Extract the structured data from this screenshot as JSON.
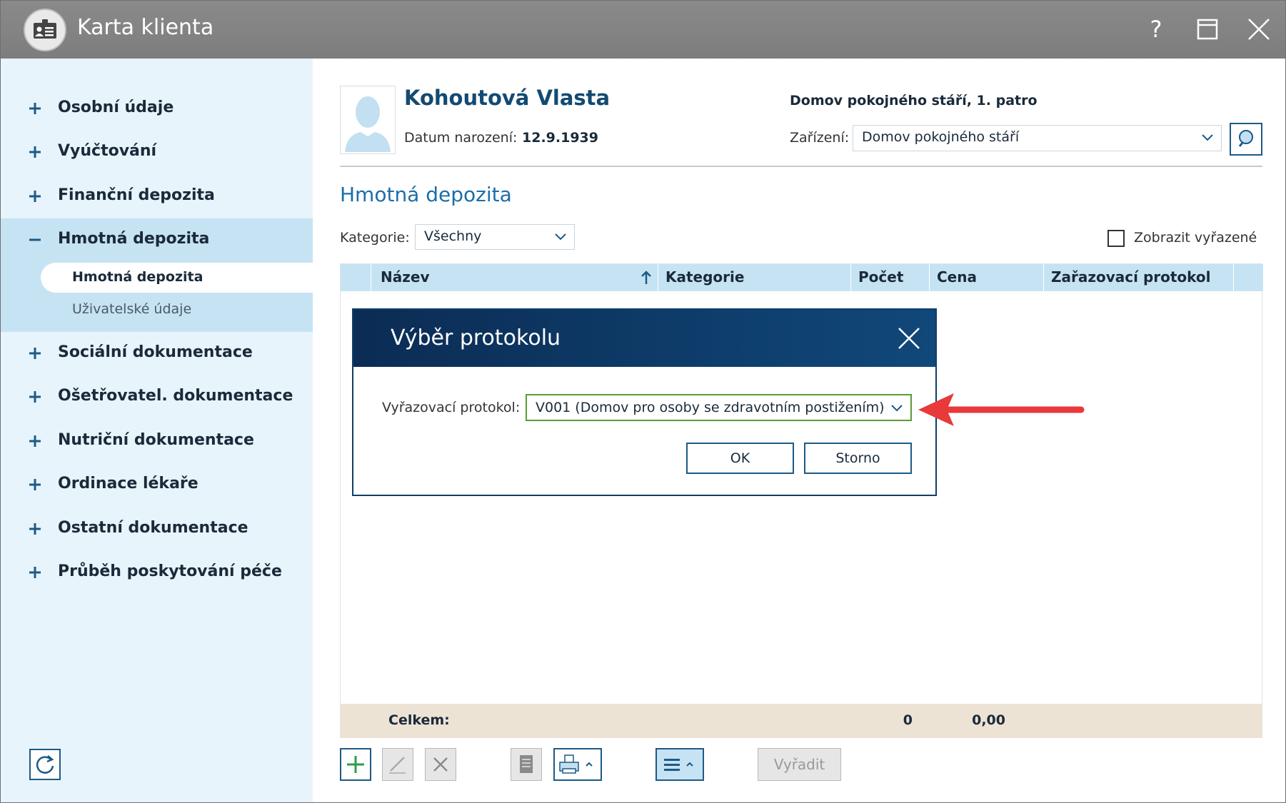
{
  "window": {
    "title": "Karta klienta",
    "help_label": "?"
  },
  "sidebar": {
    "items": [
      {
        "label": "Osobní údaje"
      },
      {
        "label": "Vyúčtování"
      },
      {
        "label": "Finanční depozita"
      },
      {
        "label": "Hmotná depozita"
      },
      {
        "label": "Sociální dokumentace"
      },
      {
        "label": "Ošetřovatel. dokumentace"
      },
      {
        "label": "Nutriční dokumentace"
      },
      {
        "label": "Ordinace lékaře"
      },
      {
        "label": "Ostatní dokumentace"
      },
      {
        "label": "Průběh poskytování péče"
      }
    ],
    "subitems": [
      {
        "label": "Hmotná depozita"
      },
      {
        "label": "Uživatelské údaje"
      }
    ]
  },
  "client": {
    "name": "Kohoutová Vlasta",
    "dob_label": "Datum narození:",
    "dob_value": "12.9.1939",
    "location": "Domov pokojného stáří, 1. patro",
    "facility_label": "Zařízení:",
    "facility_value": "Domov pokojného stáří"
  },
  "section": {
    "title": "Hmotná depozita",
    "category_label": "Kategorie:",
    "category_value": "Všechny",
    "show_discarded_label": "Zobrazit vyřazené"
  },
  "grid": {
    "columns": [
      "Název",
      "Kategorie",
      "Počet",
      "Cena",
      "Zařazovací protokol"
    ],
    "sort_icon": "arrow-up-icon",
    "footer_label": "Celkem:",
    "footer_count": "0",
    "footer_price": "0,00"
  },
  "toolbar": {
    "discard_label": "Vyřadit"
  },
  "dialog": {
    "title": "Výběr protokolu",
    "field_label": "Vyřazovací protokol:",
    "field_value": "V001 (Domov pro osoby se zdravotním postižením)",
    "ok_label": "OK",
    "cancel_label": "Storno"
  },
  "colors": {
    "titlebar": "#828282",
    "sidebar_bg": "#e8f4fb",
    "sidebar_active": "#c6e3f3",
    "accent": "#1d5a86",
    "dialog_header": "#0d3f6c",
    "annotation_arrow": "#e8393b",
    "footer_bg": "#ede3d5"
  }
}
